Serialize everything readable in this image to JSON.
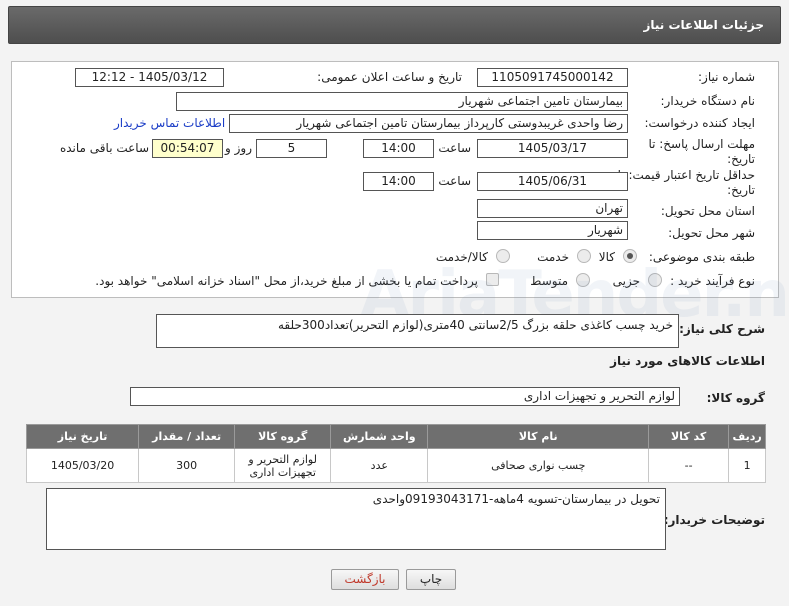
{
  "header": {
    "title": "جزئیات اطلاعات نیاز"
  },
  "form": {
    "need_number": {
      "label": "شماره نیاز:",
      "value": "1105091745000142"
    },
    "announce_datetime": {
      "label": "تاریخ و ساعت اعلان عمومی:",
      "value": "1405/03/12 - 12:12"
    },
    "buyer_org": {
      "label": "نام دستگاه خریدار:",
      "value": "بیمارستان تامین اجتماعی شهریار"
    },
    "requester": {
      "label": "ایجاد کننده درخواست:",
      "value": "رضا واحدی غریبدوستی کارپرداز بیمارستان تامین اجتماعی شهریار"
    },
    "contact_link": "اطلاعات تماس خریدار",
    "reply_deadline": {
      "label": "مهلت ارسال پاسخ: تا تاریخ:",
      "date": "1405/03/17",
      "time_label": "ساعت",
      "time": "14:00",
      "days": "5",
      "days_label": "روز و",
      "remaining": "00:54:07",
      "remaining_label": "ساعت باقی مانده"
    },
    "price_validity": {
      "label": "حداقل تاریخ اعتبار قیمت: تا تاریخ:",
      "date": "1405/06/31",
      "time_label": "ساعت",
      "time": "14:00"
    },
    "province": {
      "label": "استان محل تحویل:",
      "value": "تهران"
    },
    "city": {
      "label": "شهر محل تحویل:",
      "value": "شهریار"
    },
    "category": {
      "label": "طبقه بندی موضوعی:",
      "options": [
        "کالا",
        "خدمت",
        "کالا/خدمت"
      ],
      "selected": "کالا"
    },
    "purchase_process": {
      "label": "نوع فرآیند خرید :",
      "options": [
        "جزیی",
        "متوسط"
      ],
      "payment_note": "پرداخت تمام یا بخشی از مبلغ خرید،از محل \"اسناد خزانه اسلامی\" خواهد بود."
    }
  },
  "summary": {
    "label": "شرح کلی نیاز:",
    "value": "خرید چسب کاغذی حلقه بزرگ 2/5سانتی 40متری(لوازم التحریر)تعداد300حلقه"
  },
  "goods_section": {
    "title": "اطلاعات کالاهای مورد نیاز",
    "group_label": "گروه کالا:",
    "group_value": "لوازم التحریر و تجهیزات اداری"
  },
  "items_table": {
    "headers": [
      "ردیف",
      "کد کالا",
      "نام کالا",
      "واحد شمارش",
      "گروه کالا",
      "تعداد / مقدار",
      "تاریخ نیاز"
    ],
    "rows": [
      [
        "1",
        "--",
        "چسب نواری صحافی",
        "عدد",
        "لوازم التحریر و تجهیزات اداری",
        "300",
        "1405/03/20"
      ]
    ]
  },
  "buyer_notes": {
    "label": "توضیحات خریدار:",
    "value": "تحویل در بیمارستان-تسویه 4ماهه-09193043171واحدی"
  },
  "buttons": {
    "print": "چاپ",
    "back": "بازگشت"
  },
  "watermark": "AriaTender.net",
  "colors": {
    "header_bg": "#5a5a5a",
    "table_header_bg": "#6f6f6f",
    "link": "#1a3cc6",
    "back_text": "#c0392b"
  }
}
